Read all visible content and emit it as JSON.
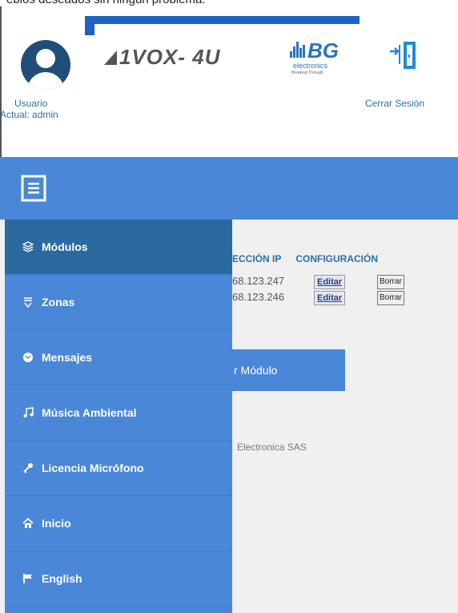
{
  "top_text": "ebios deseados sin ningún problema.",
  "header": {
    "user_label": "Usuario",
    "user_current": "Actual: admin",
    "logo_main": "1VOX- 4U",
    "logo_partner": "BG",
    "logo_partner_sub": "electronics",
    "logo_partner_tag": "Breaking Through",
    "logout_label": "Cerrar Sesión"
  },
  "sidebar": {
    "items": [
      {
        "label": "Módulos",
        "icon": "layers-icon",
        "active": true
      },
      {
        "label": "Zonas",
        "icon": "zones-icon",
        "active": false
      },
      {
        "label": "Mensajes",
        "icon": "message-icon",
        "active": false
      },
      {
        "label": "Música Ambiental",
        "icon": "music-icon",
        "active": false
      },
      {
        "label": "Licencia Micrófono",
        "icon": "key-icon",
        "active": false
      },
      {
        "label": "Inicio",
        "icon": "home-icon",
        "active": false
      },
      {
        "label": "English",
        "icon": "flag-icon",
        "active": false
      }
    ]
  },
  "table": {
    "col_ip": "ECCIÓN IP",
    "col_config": "CONFIGURACIÓN",
    "rows": [
      {
        "ip": "68.123.247",
        "edit": "Editar",
        "delete": "Borrar"
      },
      {
        "ip": "68.123.246",
        "edit": "Editar",
        "delete": "Borrar"
      }
    ]
  },
  "add_button_label": "r Módulo",
  "footer_text": "Electronica SAS",
  "colors": {
    "accent": "#4a87d8",
    "active": "#2a6a9e",
    "brand_dark": "#1f4e79"
  }
}
